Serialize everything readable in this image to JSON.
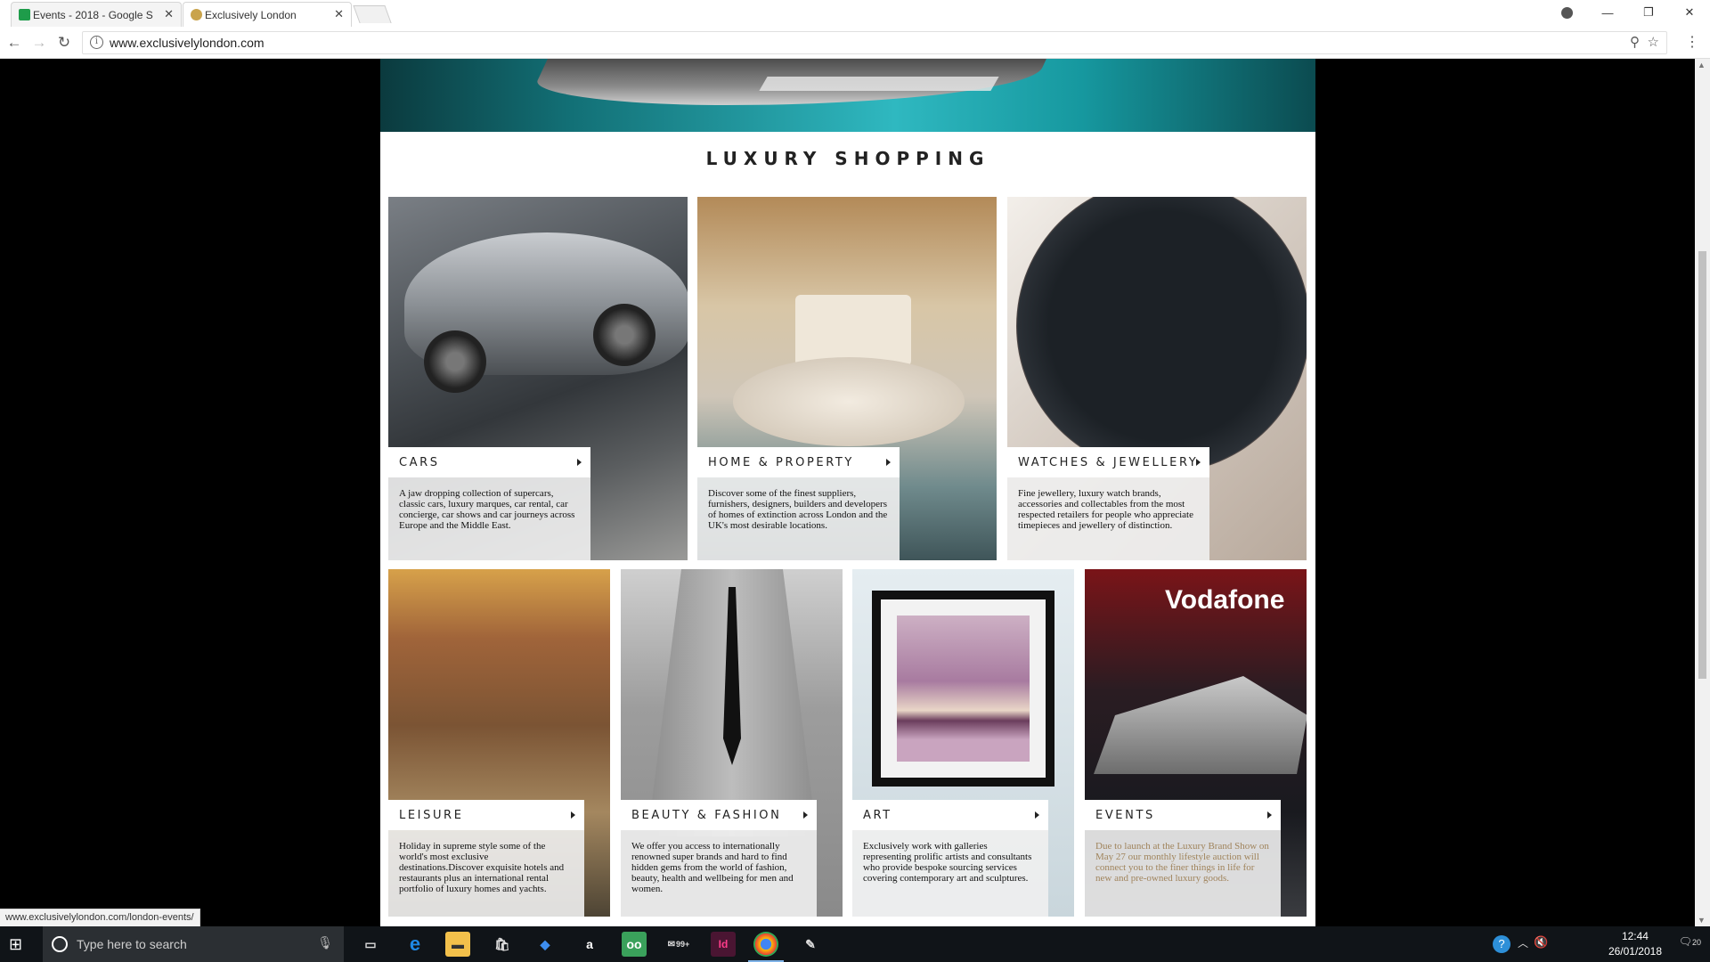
{
  "browser": {
    "tabs": [
      {
        "label": "Events - 2018 - Google S",
        "active": false,
        "favicon": "sheets-icon",
        "color": "#1e9c4a"
      },
      {
        "label": "Exclusively London",
        "active": true,
        "favicon": "site-logo-icon",
        "color": "#c9a34b"
      }
    ],
    "url": "www.exclusivelylondon.com",
    "status_url": "www.exclusivelylondon.com/london-events/"
  },
  "page": {
    "section_title": "LUXURY SHOPPING",
    "cards": [
      {
        "title": "CARS",
        "desc": "A jaw dropping collection of supercars, classic cars, luxury marques, car rental, car concierge, car shows and car journeys across Europe and the Middle East."
      },
      {
        "title": "HOME & PROPERTY",
        "desc": "Discover some of the finest suppliers, furnishers, designers, builders and developers of homes of extinction across London and the UK's most desirable locations."
      },
      {
        "title": "WATCHES & JEWELLERY",
        "desc": "Fine jewellery, luxury watch brands, accessories and collectables from the most respected retailers for people who appreciate timepieces and jewellery of distinction."
      },
      {
        "title": "LEISURE",
        "desc": "Holiday in supreme style some of the world's most exclusive destinations.Discover exquisite hotels and restaurants plus an international rental portfolio of luxury homes and yachts."
      },
      {
        "title": "BEAUTY & FASHION",
        "desc": "We offer you access to internationally renowned super brands and hard to find hidden gems from the world of fashion, beauty, health and wellbeing for men and women."
      },
      {
        "title": "ART",
        "desc": "Exclusively work with galleries representing prolific artists and consultants who provide bespoke sourcing services covering contemporary art and sculptures."
      },
      {
        "title": "EVENTS",
        "desc": "Due to launch at the Luxury Brand Show on May 27 our monthly lifestyle auction will connect you to the finer things in life for new and pre-owned luxury goods."
      }
    ],
    "events_wordmark": "Vodafone"
  },
  "taskbar": {
    "search_placeholder": "Type here to search",
    "time": "12:44",
    "date": "26/01/2018",
    "notifications": "20",
    "badge": "99+"
  },
  "colors": {
    "events_desc": "#a0845c",
    "hero_accent": "#2fb8c0"
  }
}
